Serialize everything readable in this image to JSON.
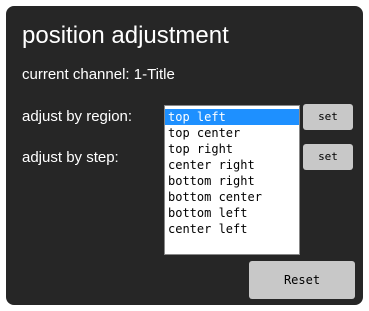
{
  "panel": {
    "title": "position adjustment",
    "current_channel": "current channel: 1-Title",
    "adjust_by_region_label": "adjust by region:",
    "adjust_by_step_label": "adjust by step:"
  },
  "region_select": {
    "options": [
      "top left",
      "top center",
      "top right",
      "center right",
      "bottom right",
      "bottom center",
      "bottom left",
      "center left"
    ],
    "selected": "top left"
  },
  "buttons": {
    "set_region": "set",
    "set_step": "set",
    "reset": "Reset"
  },
  "colors": {
    "panel_bg": "#262626",
    "selected_bg": "#1e90ff",
    "button_bg": "#c8c8c8"
  }
}
